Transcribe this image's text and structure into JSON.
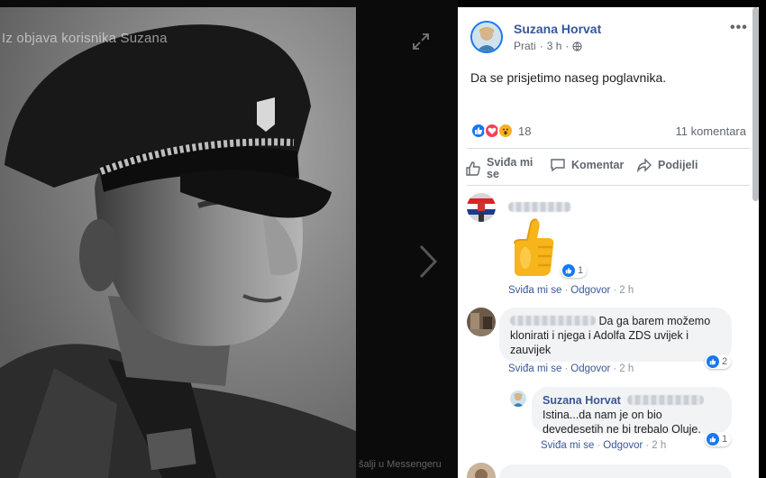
{
  "viewer": {
    "overlay_title": "Iz objava korisnika Suzana",
    "messenger_hint": "šalji u Messengeru",
    "expand_icon": "expand-icon",
    "next_icon": "chevron-right-icon"
  },
  "post": {
    "author": "Suzana Horvat",
    "follow": "Prati",
    "time": "3 h",
    "privacy_icon": "globe-icon",
    "more": "•••",
    "text": "Da se prisjetimo naseg poglavnika.",
    "reaction_count": "18",
    "reaction_icons": [
      "like-icon",
      "love-icon",
      "wow-icon"
    ],
    "comment_count": "11 komentara"
  },
  "actions": {
    "like": "Sviđa mi se",
    "comment": "Komentar",
    "share": "Podijeli"
  },
  "comments": [
    {
      "sticker": "thumbs-up-sticker",
      "like_label": "Sviđa mi se",
      "reply_label": "Odgovor",
      "time": "2 h",
      "likes": "1"
    },
    {
      "text": "Da ga barem možemo klonirati i njega i Adolfa ZDS uvijek i zauvijek",
      "like_label": "Sviđa mi se",
      "reply_label": "Odgovor",
      "time": "2 h",
      "likes": "2"
    },
    {
      "author": "Suzana Horvat",
      "text": "Istina...da nam je on bio devedesetih ne bi trebalo Oluje.",
      "like_label": "Sviđa mi se",
      "reply_label": "Odgovor",
      "time": "2 h",
      "likes": "1"
    }
  ],
  "colors": {
    "link": "#385898",
    "like_blue": "#1877f2",
    "love_red": "#f33e58",
    "wow_yellow": "#f7b125"
  }
}
